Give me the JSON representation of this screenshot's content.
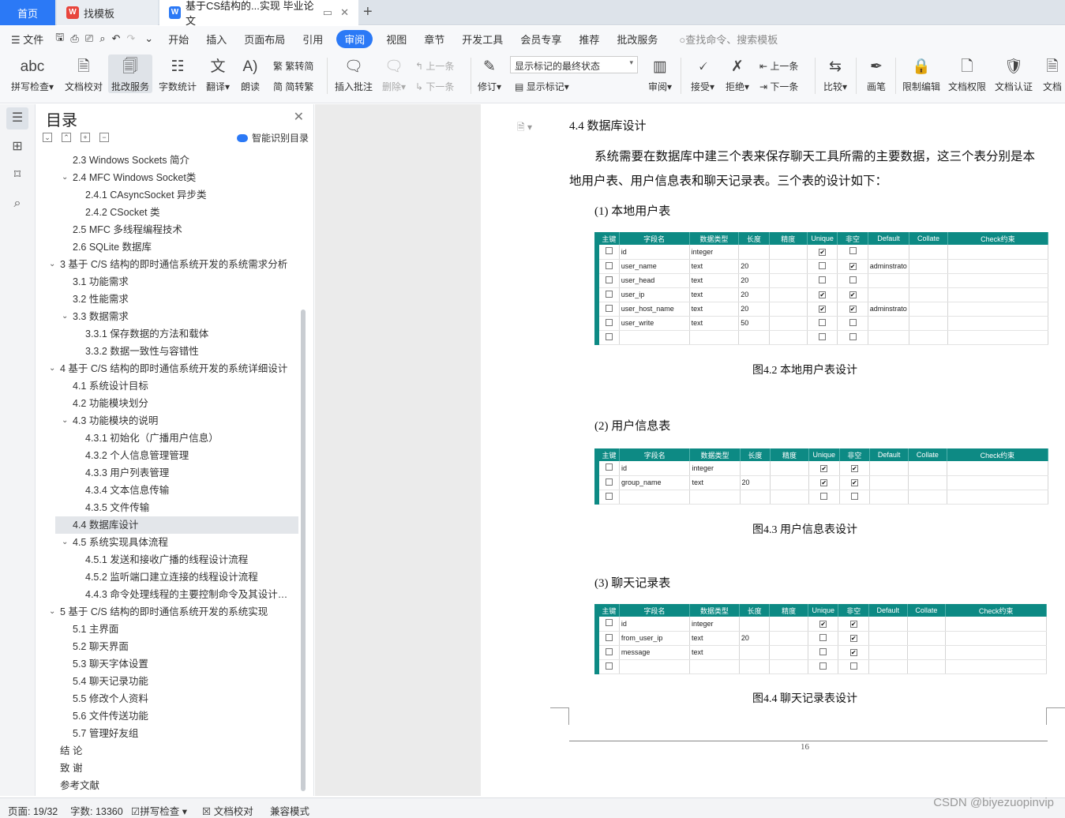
{
  "tabs": {
    "home": "首页",
    "templates": "找模板",
    "doc": "基于CS结构的...实现 毕业论文"
  },
  "menu": {
    "file": "文件",
    "items": [
      "开始",
      "插入",
      "页面布局",
      "引用",
      "审阅",
      "视图",
      "章节",
      "开发工具",
      "会员专享",
      "推荐",
      "批改服务"
    ],
    "active": "审阅",
    "search": "查找命令、搜索模板"
  },
  "ribbon": {
    "spell": "拼写检查",
    "proof": "文档校对",
    "correct": "批改服务",
    "wordcount": "字数统计",
    "translate": "翻译",
    "read": "朗读",
    "trad": "繁转简",
    "simp": "简转繁",
    "insert_comment": "插入批注",
    "delete": "删除",
    "prev": "上一条",
    "next": "下一条",
    "track": "修订",
    "markup_state": "显示标记的最终状态",
    "show_markup": "显示标记",
    "review": "审阅",
    "accept": "接受",
    "reject": "拒绝",
    "prev2": "上一条",
    "next2": "下一条",
    "compare": "比较",
    "pen": "画笔",
    "restrict": "限制编辑",
    "rights": "文档权限",
    "cert": "文档认证",
    "more": "文档"
  },
  "outline": {
    "title": "目录",
    "smart": "智能识别目录",
    "items": [
      {
        "t": "2.3    Windows Sockets 简介",
        "lv": 2,
        "a": ""
      },
      {
        "t": "2.4    MFC Windows Socket类",
        "lv": 2,
        "a": "v"
      },
      {
        "t": "2.4.1    CAsyncSocket 异步类",
        "lv": 3,
        "a": ""
      },
      {
        "t": "2.4.2    CSocket 类",
        "lv": 3,
        "a": ""
      },
      {
        "t": "2.5    MFC 多线程编程技术",
        "lv": 2,
        "a": ""
      },
      {
        "t": "2.6    SQLite 数据库",
        "lv": 2,
        "a": ""
      },
      {
        "t": "3  基于 C/S 结构的即时通信系统开发的系统需求分析",
        "lv": 1,
        "a": "v"
      },
      {
        "t": "3.1  功能需求",
        "lv": 2,
        "a": ""
      },
      {
        "t": "3.2  性能需求",
        "lv": 2,
        "a": ""
      },
      {
        "t": "3.3  数据需求",
        "lv": 2,
        "a": "v"
      },
      {
        "t": "3.3.1  保存数据的方法和载体",
        "lv": 3,
        "a": ""
      },
      {
        "t": "3.3.2  数据一致性与容错性",
        "lv": 3,
        "a": ""
      },
      {
        "t": "4  基于 C/S 结构的即时通信系统开发的系统详细设计",
        "lv": 1,
        "a": "v"
      },
      {
        "t": "4.1  系统设计目标",
        "lv": 2,
        "a": ""
      },
      {
        "t": "4.2  功能模块划分",
        "lv": 2,
        "a": ""
      },
      {
        "t": "4.3  功能模块的说明",
        "lv": 2,
        "a": "v"
      },
      {
        "t": "4.3.1  初始化（广播用户信息）",
        "lv": 3,
        "a": ""
      },
      {
        "t": "4.3.2  个人信息管理管理",
        "lv": 3,
        "a": ""
      },
      {
        "t": "4.3.3  用户列表管理",
        "lv": 3,
        "a": ""
      },
      {
        "t": "4.3.4  文本信息传输",
        "lv": 3,
        "a": ""
      },
      {
        "t": "4.3.5  文件传输",
        "lv": 3,
        "a": ""
      },
      {
        "t": "4.4  数据库设计",
        "lv": 2,
        "a": "",
        "hl": true
      },
      {
        "t": "4.5  系统实现具体流程",
        "lv": 2,
        "a": "v"
      },
      {
        "t": "4.5.1  发送和接收广播的线程设计流程",
        "lv": 3,
        "a": ""
      },
      {
        "t": "4.5.2  监听端口建立连接的线程设计流程",
        "lv": 3,
        "a": ""
      },
      {
        "t": "4.4.3  命令处理线程的主要控制命令及其设计流程",
        "lv": 3,
        "a": ""
      },
      {
        "t": "5  基于 C/S 结构的即时通信系统开发的系统实现",
        "lv": 1,
        "a": "v"
      },
      {
        "t": "5.1  主界面",
        "lv": 2,
        "a": ""
      },
      {
        "t": "5.2  聊天界面",
        "lv": 2,
        "a": ""
      },
      {
        "t": "5.3  聊天字体设置",
        "lv": 2,
        "a": ""
      },
      {
        "t": "5.4  聊天记录功能",
        "lv": 2,
        "a": ""
      },
      {
        "t": "5.5  修改个人资料",
        "lv": 2,
        "a": ""
      },
      {
        "t": "5.6  文件传送功能",
        "lv": 2,
        "a": ""
      },
      {
        "t": "5.7  管理好友组",
        "lv": 2,
        "a": ""
      },
      {
        "t": "结  论",
        "lv": 1,
        "a": ""
      },
      {
        "t": "致  谢",
        "lv": 1,
        "a": ""
      },
      {
        "t": "参考文献",
        "lv": 1,
        "a": ""
      }
    ]
  },
  "doc": {
    "heading": "4.4  数据库设计",
    "para1": "系统需要在数据库中建三个表来保存聊天工具所需的主要数据，这三个表分别是本",
    "para2": "地用户表、用户信息表和聊天记录表。三个表的设计如下：",
    "sub1": "(1) 本地用户表",
    "cap1": "图4.2  本地用户表设计",
    "sub2": "(2) 用户信息表",
    "cap2": "图4.3  用户信息表设计",
    "sub3": "(3) 聊天记录表",
    "cap3": "图4.4  聊天记录表设计",
    "page_no": "16",
    "headers": [
      "主键",
      "字段名",
      "数据类型",
      "长度",
      "精度",
      "Unique",
      "非空",
      "Default",
      "Collate",
      "Check约束"
    ],
    "table1": [
      {
        "pk": false,
        "name": "id",
        "type": "integer",
        "len": "",
        "uq": true,
        "nn": false,
        "def": ""
      },
      {
        "pk": false,
        "name": "user_name",
        "type": "text",
        "len": "20",
        "uq": false,
        "nn": true,
        "def": "adminstrato"
      },
      {
        "pk": false,
        "name": "user_head",
        "type": "text",
        "len": "20",
        "uq": false,
        "nn": false,
        "def": ""
      },
      {
        "pk": false,
        "name": "user_ip",
        "type": "text",
        "len": "20",
        "uq": true,
        "nn": true,
        "def": ""
      },
      {
        "pk": false,
        "name": "user_host_name",
        "type": "text",
        "len": "20",
        "uq": true,
        "nn": true,
        "def": "adminstrato"
      },
      {
        "pk": false,
        "name": "user_write",
        "type": "text",
        "len": "50",
        "uq": false,
        "nn": false,
        "def": ""
      },
      {
        "pk": false,
        "name": "",
        "type": "",
        "len": "",
        "uq": false,
        "nn": false,
        "def": ""
      }
    ],
    "table2": [
      {
        "pk": false,
        "name": "id",
        "type": "integer",
        "len": "",
        "uq": true,
        "nn": true,
        "def": ""
      },
      {
        "pk": false,
        "name": "group_name",
        "type": "text",
        "len": "20",
        "uq": true,
        "nn": true,
        "def": ""
      },
      {
        "pk": false,
        "name": "",
        "type": "",
        "len": "",
        "uq": false,
        "nn": false,
        "def": ""
      }
    ],
    "table3": [
      {
        "pk": false,
        "name": "id",
        "type": "integer",
        "len": "",
        "uq": true,
        "nn": true,
        "def": ""
      },
      {
        "pk": false,
        "name": "from_user_ip",
        "type": "text",
        "len": "20",
        "uq": false,
        "nn": true,
        "def": ""
      },
      {
        "pk": false,
        "name": "message",
        "type": "text",
        "len": "",
        "uq": false,
        "nn": true,
        "def": ""
      },
      {
        "pk": false,
        "name": "",
        "type": "",
        "len": "",
        "uq": false,
        "nn": false,
        "def": ""
      }
    ]
  },
  "status": {
    "page": "页面: 19/32",
    "words": "字数: 13360",
    "spell": "拼写检查",
    "proof": "文档校对",
    "compat": "兼容模式"
  },
  "watermark": "CSDN @biyezuopinvip"
}
